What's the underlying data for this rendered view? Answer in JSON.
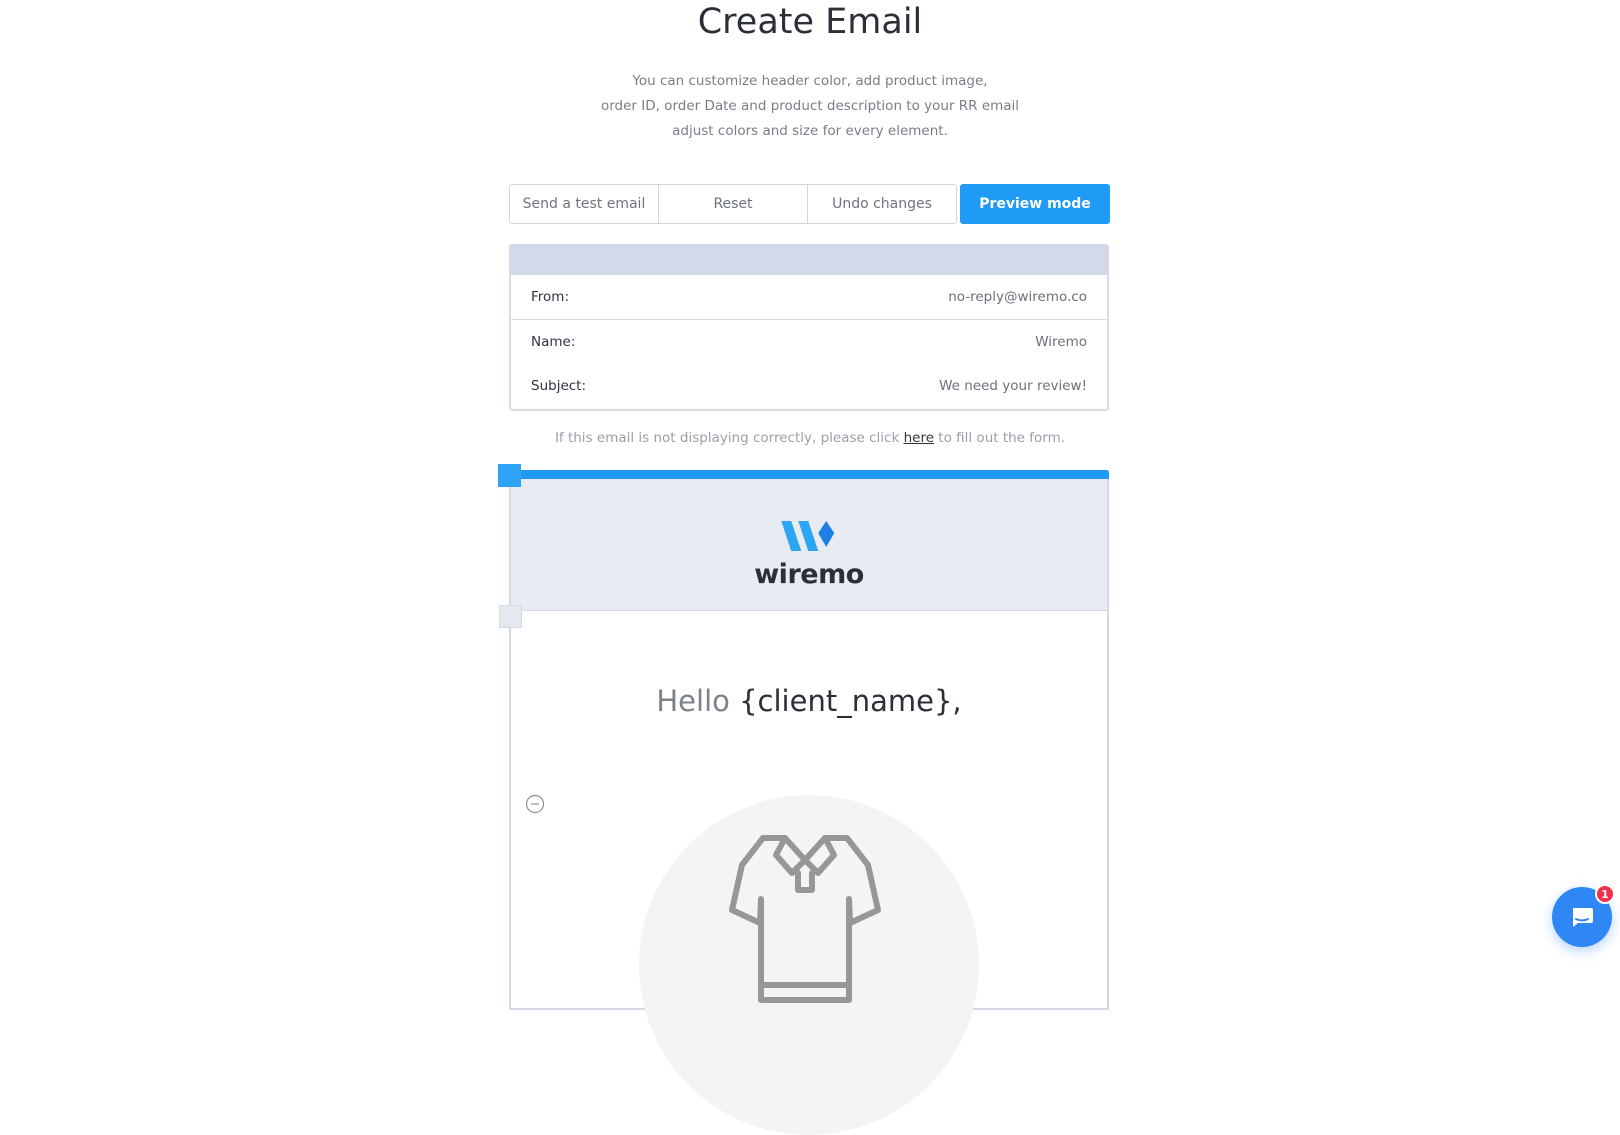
{
  "page": {
    "title": "Create Email",
    "intro_lines": [
      "You can customize header color, add product image,",
      "order ID, order Date and product description to your RR email",
      "adjust colors and size for every element."
    ]
  },
  "toolbar": {
    "send_test_label": "Send a test email",
    "reset_label": "Reset",
    "undo_label": "Undo changes",
    "preview_label": "Preview mode"
  },
  "email_meta": {
    "from_label": "From:",
    "from_value": "no-reply@wiremo.co",
    "name_label": "Name:",
    "name_value": "Wiremo",
    "subject_label": "Subject:",
    "subject_value": "We need your review!"
  },
  "notice": {
    "before": "If this email is not displaying correctly, please click",
    "link": "here",
    "after": "to fill out the form."
  },
  "email": {
    "logo_text": "wiremo",
    "greeting_hello": "Hello",
    "greeting_var": "{client_name},",
    "product_icon": "shirt-icon"
  },
  "chat": {
    "icon": "chat-icon",
    "badge_count": "1"
  },
  "colors": {
    "accent": "#1f9bf5",
    "header_bg": "#e8ebf1",
    "meta_bar": "#d4d9e9",
    "chat_bg": "#2f86f5",
    "badge": "#f0314b"
  }
}
